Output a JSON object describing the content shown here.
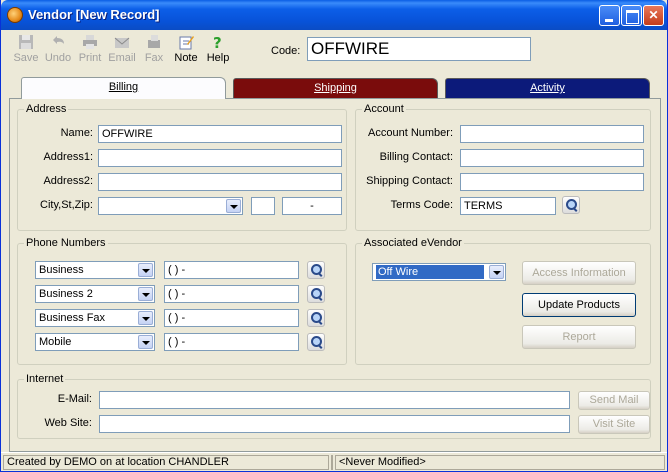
{
  "window": {
    "title": "Vendor [New Record]",
    "controls": {
      "minimize": "",
      "maximize": "",
      "close": "✕"
    }
  },
  "toolbar": {
    "items": [
      {
        "label": "Save",
        "icon": "floppy-disk-icon",
        "enabled": false
      },
      {
        "label": "Undo",
        "icon": "undo-arrow-icon",
        "enabled": false
      },
      {
        "label": "Print",
        "icon": "printer-icon",
        "enabled": false
      },
      {
        "label": "Email",
        "icon": "email-icon",
        "enabled": false
      },
      {
        "label": "Fax",
        "icon": "fax-icon",
        "enabled": false
      },
      {
        "label": "Note",
        "icon": "note-icon",
        "enabled": true
      },
      {
        "label": "Help",
        "icon": "help-question-icon",
        "enabled": true
      }
    ],
    "code_label": "Code:",
    "code_value": "OFFWIRE"
  },
  "tabs": [
    {
      "label": "Billing",
      "active": true,
      "color": "#fcfcfe"
    },
    {
      "label": "Shipping",
      "active": false,
      "color": "#7a0c0c"
    },
    {
      "label": "Activity",
      "active": false,
      "color": "#0c1a7a"
    }
  ],
  "address": {
    "title": "Address",
    "name_label": "Name:",
    "name_value": "OFFWIRE",
    "address1_label": "Address1:",
    "address1_value": "",
    "address2_label": "Address2:",
    "address2_value": "",
    "city_label": "City,St,Zip:",
    "city_value": "",
    "state_value": "",
    "zip_value": "-"
  },
  "account": {
    "title": "Account",
    "account_number_label": "Account Number:",
    "account_number_value": "",
    "billing_contact_label": "Billing Contact:",
    "billing_contact_value": "",
    "shipping_contact_label": "Shipping Contact:",
    "shipping_contact_value": "",
    "terms_code_label": "Terms Code:",
    "terms_code_value": "TERMS"
  },
  "phones": {
    "title": "Phone Numbers",
    "rows": [
      {
        "type": "Business",
        "number": "(   )    -"
      },
      {
        "type": "Business 2",
        "number": "(   )    -"
      },
      {
        "type": "Business Fax",
        "number": "(   )    -"
      },
      {
        "type": "Mobile",
        "number": "(   )    -"
      }
    ]
  },
  "evendor": {
    "title": "Associated eVendor",
    "selected": "Off Wire",
    "access_info_label": "Access Information",
    "update_products_label": "Update Products",
    "report_label": "Report"
  },
  "internet": {
    "title": "Internet",
    "email_label": "E-Mail:",
    "email_value": "",
    "website_label": "Web Site:",
    "website_value": "",
    "send_mail_label": "Send Mail",
    "visit_site_label": "Visit Site"
  },
  "status": {
    "created": "Created by DEMO on  at location CHANDLER",
    "middle": "",
    "modified": "<Never Modified>"
  }
}
